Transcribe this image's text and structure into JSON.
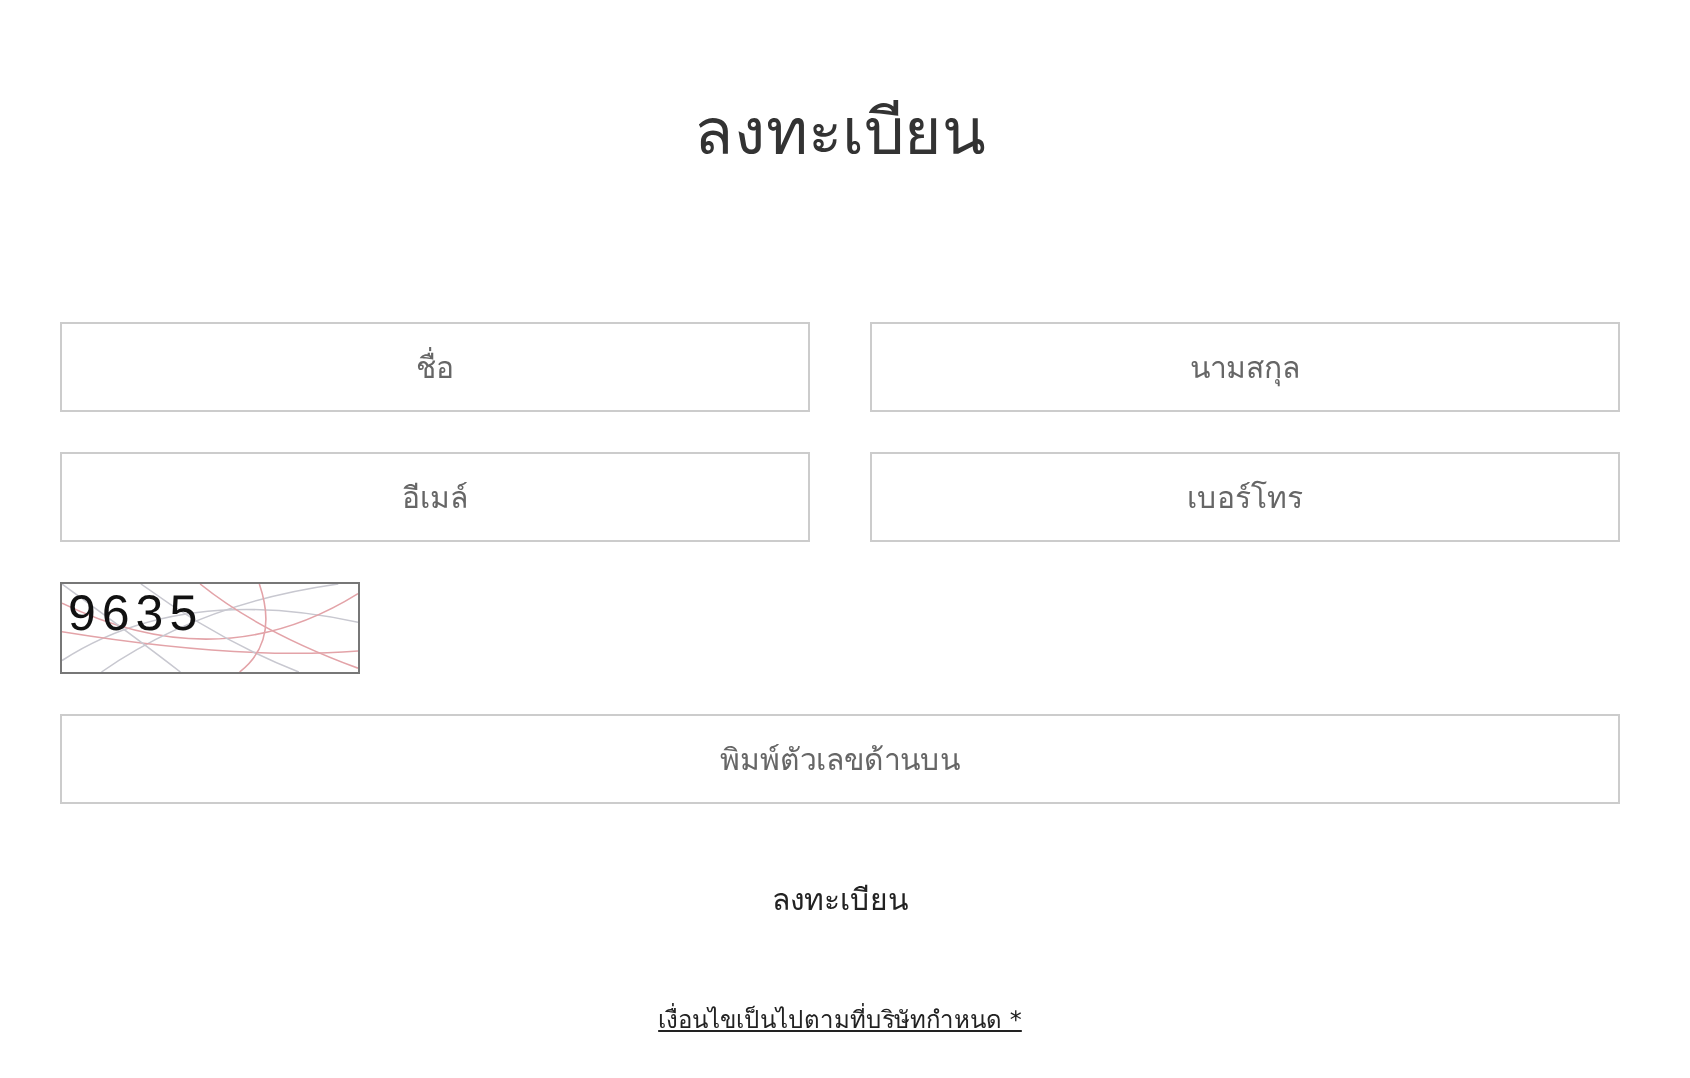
{
  "title": "ลงทะเบียน",
  "fields": [
    {
      "placeholder": "ชื่อ"
    },
    {
      "placeholder": "นามสกุล"
    },
    {
      "placeholder": "อีเมล์"
    },
    {
      "placeholder": "เบอร์โทร"
    }
  ],
  "captcha": {
    "code": "9635"
  },
  "captcha_field": {
    "placeholder": "พิมพ์ตัวเลขด้านบน"
  },
  "submit": "ลงทะเบียน",
  "terms_link": "เงื่อนไขเป็นไปตามที่บริษัทกำหนด *"
}
